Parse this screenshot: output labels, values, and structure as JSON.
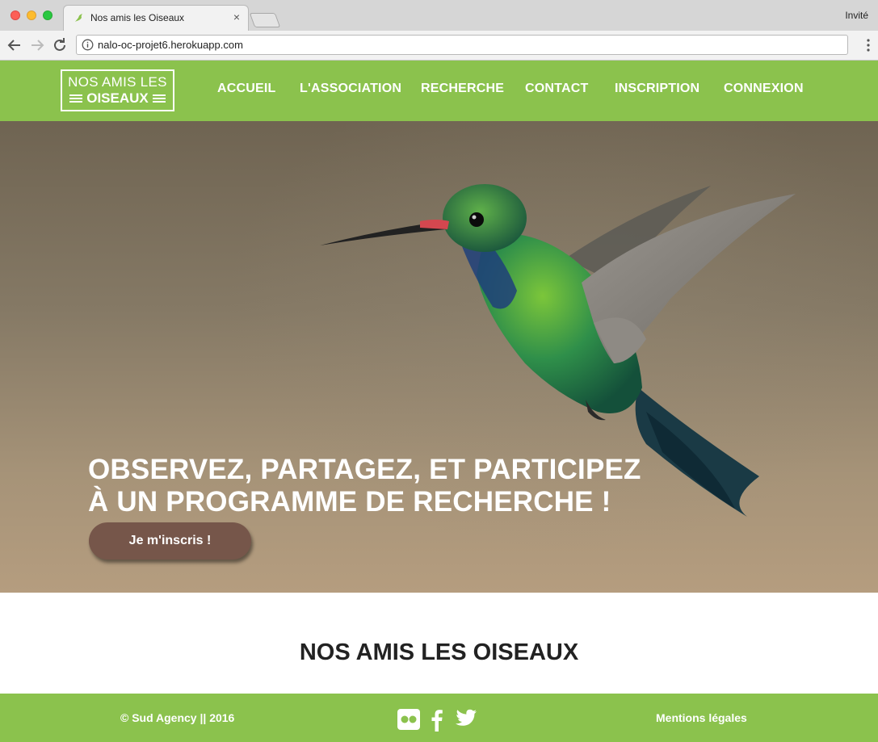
{
  "browser": {
    "tab_title": "Nos amis les Oiseaux",
    "tab_close": "×",
    "profile": "Invité",
    "url": "nalo-oc-projet6.herokuapp.com"
  },
  "site": {
    "logo": {
      "line1": "NOS AMIS LES",
      "line2": "OISEAUX"
    },
    "nav": [
      {
        "label": "ACCUEIL"
      },
      {
        "label": "L'ASSOCIATION"
      },
      {
        "label": "RECHERCHE"
      },
      {
        "label": "CONTACT"
      },
      {
        "label": "INSCRIPTION"
      },
      {
        "label": "CONNEXION"
      }
    ],
    "colors": {
      "brand_green": "#8bc24d",
      "cta_brown": "#76564a"
    }
  },
  "hero": {
    "headline_line1": "OBSERVEZ, PARTAGEZ, ET PARTICIPEZ",
    "headline_line2": "À UN PROGRAMME DE RECHERCHE !",
    "cta_label": "Je m'inscris !"
  },
  "section": {
    "title": "NOS AMIS LES OISEAUX"
  },
  "footer": {
    "copyright": "© Sud Agency || 2016",
    "legal": "Mentions légales",
    "social_icons": [
      "flickr-icon",
      "facebook-icon",
      "twitter-icon"
    ]
  }
}
